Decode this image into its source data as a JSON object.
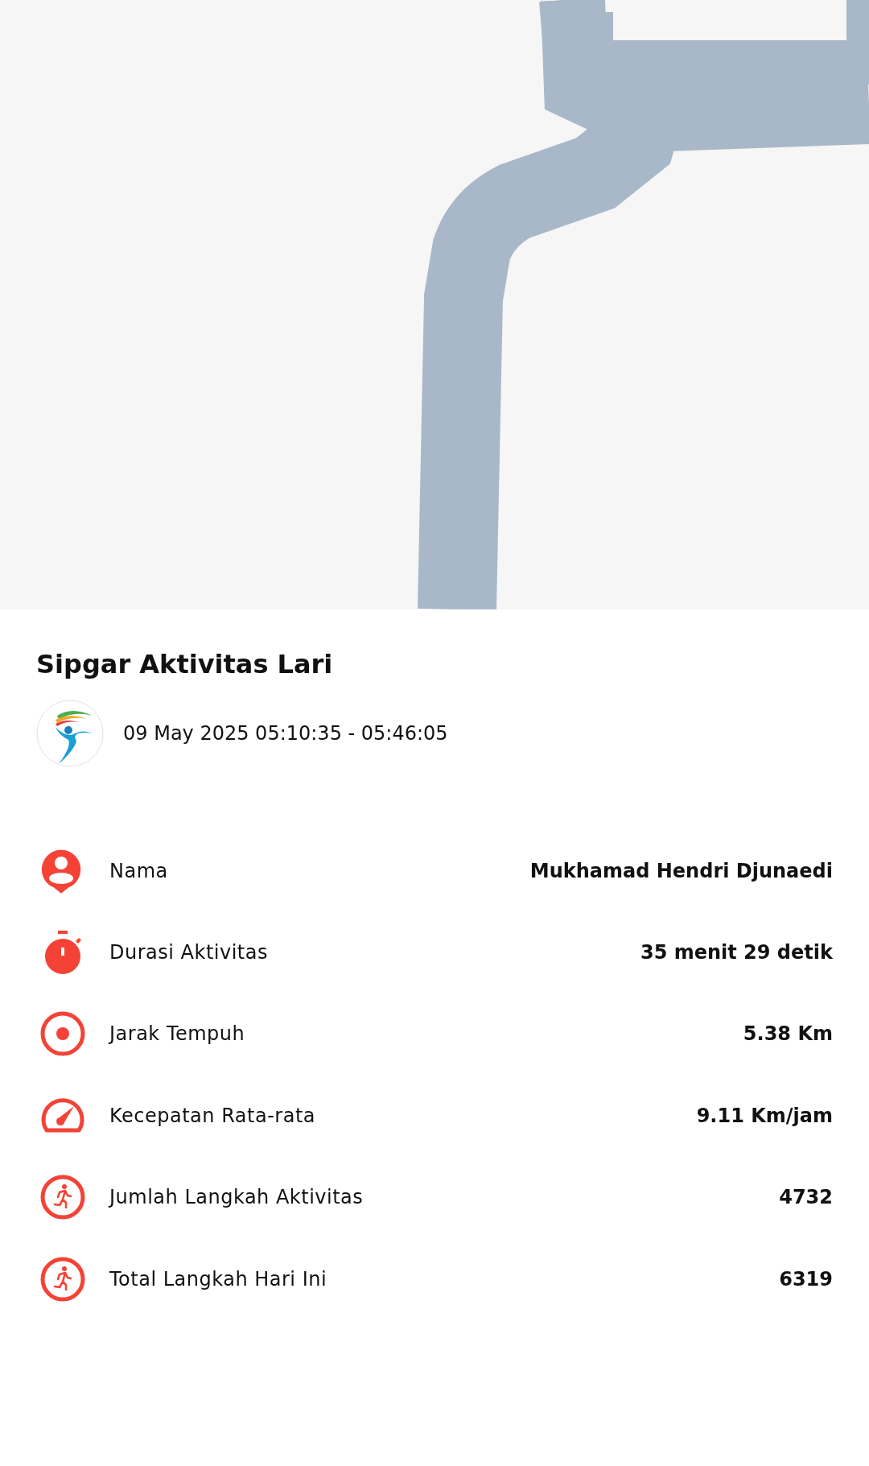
{
  "title": "Sipgar Aktivitas Lari",
  "session": {
    "time_range": "09 May 2025 05:10:35 - 05:46:05"
  },
  "stats": [
    {
      "kind": "person",
      "label": "Nama",
      "value": "Mukhamad Hendri Djunaedi"
    },
    {
      "kind": "stopwatch",
      "label": "Durasi Aktivitas",
      "value": "35 menit 29 detik"
    },
    {
      "kind": "target",
      "label": "Jarak Tempuh",
      "value": "5.38 Km"
    },
    {
      "kind": "speedometer",
      "label": "Kecepatan Rata-rata",
      "value": "9.11 Km/jam"
    },
    {
      "kind": "runner",
      "label": "Jumlah Langkah Aktivitas",
      "value": "4732"
    },
    {
      "kind": "runner",
      "label": "Total Langkah Hari Ini",
      "value": "6319"
    }
  ]
}
